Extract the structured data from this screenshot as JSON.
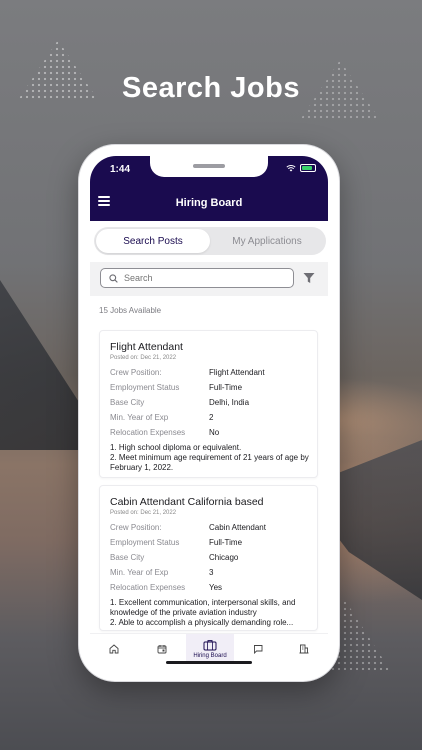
{
  "headline": "Search Jobs",
  "status_bar": {
    "time": "1:44"
  },
  "header": {
    "title": "Hiring Board",
    "menu_icon": "hamburger-menu-icon"
  },
  "tabs": [
    {
      "label": "Search Posts",
      "active": true
    },
    {
      "label": "My Applications",
      "active": false
    }
  ],
  "search": {
    "placeholder": "Search",
    "value": ""
  },
  "jobs_count": "15 Jobs Available",
  "jobs": [
    {
      "title": "Flight Attendant",
      "posted": "Posted on: Dec 21, 2022",
      "fields": [
        {
          "label": "Crew Position:",
          "value": "Flight Attendant"
        },
        {
          "label": "Employment Status",
          "value": "Full-Time"
        },
        {
          "label": "Base City",
          "value": "Delhi, India"
        },
        {
          "label": "Min. Year of Exp",
          "value": "2"
        },
        {
          "label": "Relocation Expenses",
          "value": "No"
        }
      ],
      "description": [
        "1. High school diploma or equivalent.",
        "2. Meet minimum age requirement of 21 years of age by February 1, 2022."
      ]
    },
    {
      "title": "Cabin Attendant  California based",
      "posted": "Posted on: Dec 21, 2022",
      "fields": [
        {
          "label": "Crew Position:",
          "value": "Cabin Attendant"
        },
        {
          "label": "Employment Status",
          "value": "Full-Time"
        },
        {
          "label": "Base City",
          "value": "Chicago"
        },
        {
          "label": "Min. Year of Exp",
          "value": "3"
        },
        {
          "label": "Relocation Expenses",
          "value": "Yes"
        }
      ],
      "description": [
        "1. Excellent communication, interpersonal skills, and knowledge of the private aviation industry",
        "2. Able to accomplish a physically demanding role..."
      ]
    }
  ],
  "bottom_nav": [
    {
      "icon": "home-icon",
      "label": ""
    },
    {
      "icon": "calendar-icon",
      "label": ""
    },
    {
      "icon": "briefcase-icon",
      "label": "Hiring Board",
      "active": true
    },
    {
      "icon": "chat-icon",
      "label": ""
    },
    {
      "icon": "building-icon",
      "label": ""
    }
  ],
  "colors": {
    "primary": "#1a0b4f",
    "background": "#ffffff"
  }
}
